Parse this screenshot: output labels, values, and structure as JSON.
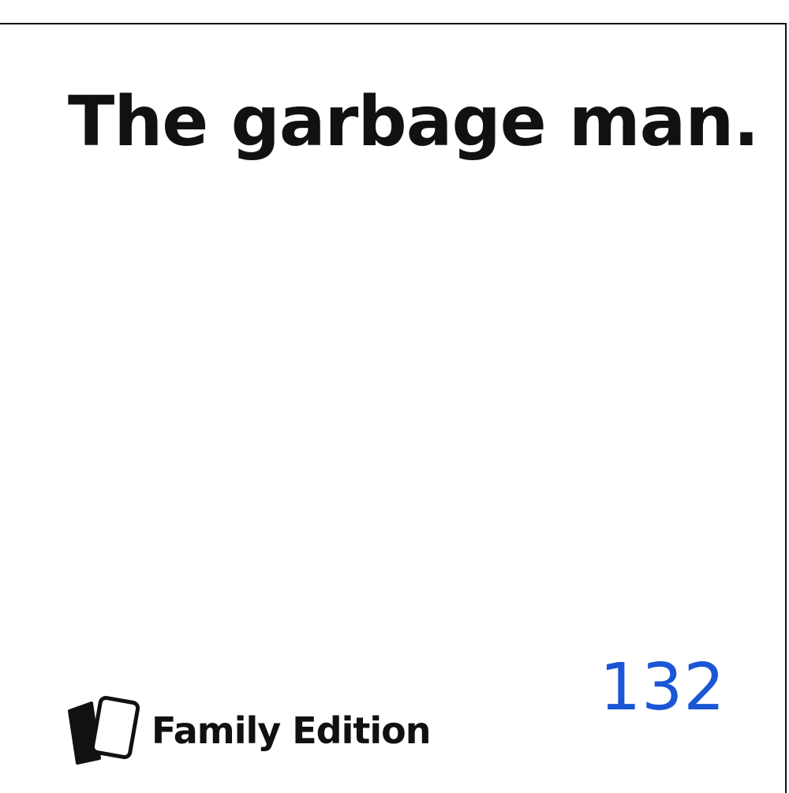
{
  "card": {
    "text": "The garbage man.",
    "number": "132"
  },
  "brand": {
    "name": "Family Edition",
    "icon": "cards-icon"
  },
  "colors": {
    "text": "#111111",
    "number": "#1a56d6",
    "background": "#ffffff"
  }
}
